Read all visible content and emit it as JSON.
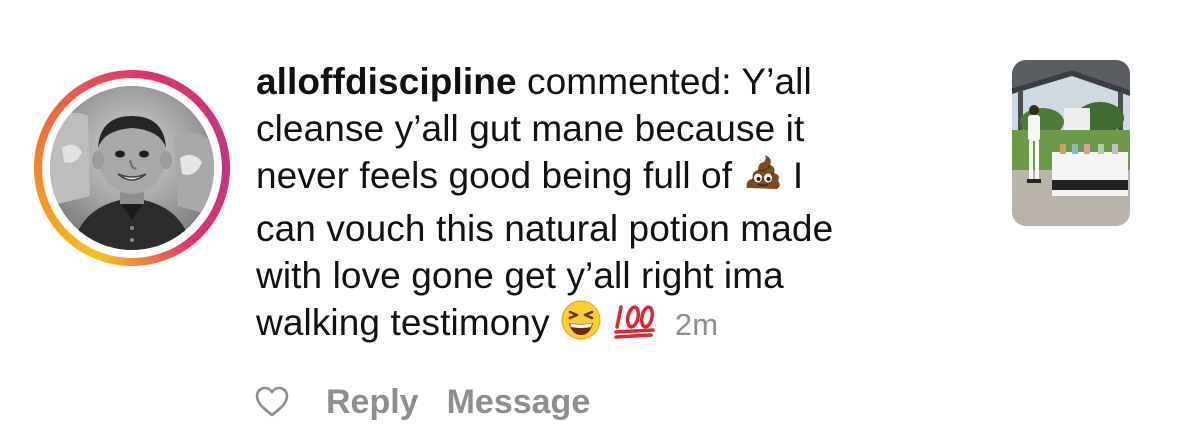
{
  "comment": {
    "username": "alloffdiscipline",
    "verb": "commented:",
    "line1_rest": "Y’all",
    "line2": "cleanse y’all gut mane because it",
    "line3_text": "never feels good being full of",
    "line3_emoji": "pile-of-poo",
    "line3_end": "I",
    "line4": "can vouch this natural potion made",
    "line5": "with love gone get y’all right ima",
    "line6_text": "walking testimony",
    "line6_emojis": [
      "grinning-squinting-face",
      "hundred-points"
    ],
    "time": "2m"
  },
  "actions": {
    "like_icon": "heart-outline-icon",
    "reply_label": "Reply",
    "message_label": "Message"
  },
  "colors": {
    "ring_gradient": [
      "#f7c21c",
      "#f58529",
      "#e1306c",
      "#c13584"
    ],
    "text": "#111111",
    "muted": "#8e8e8e"
  }
}
